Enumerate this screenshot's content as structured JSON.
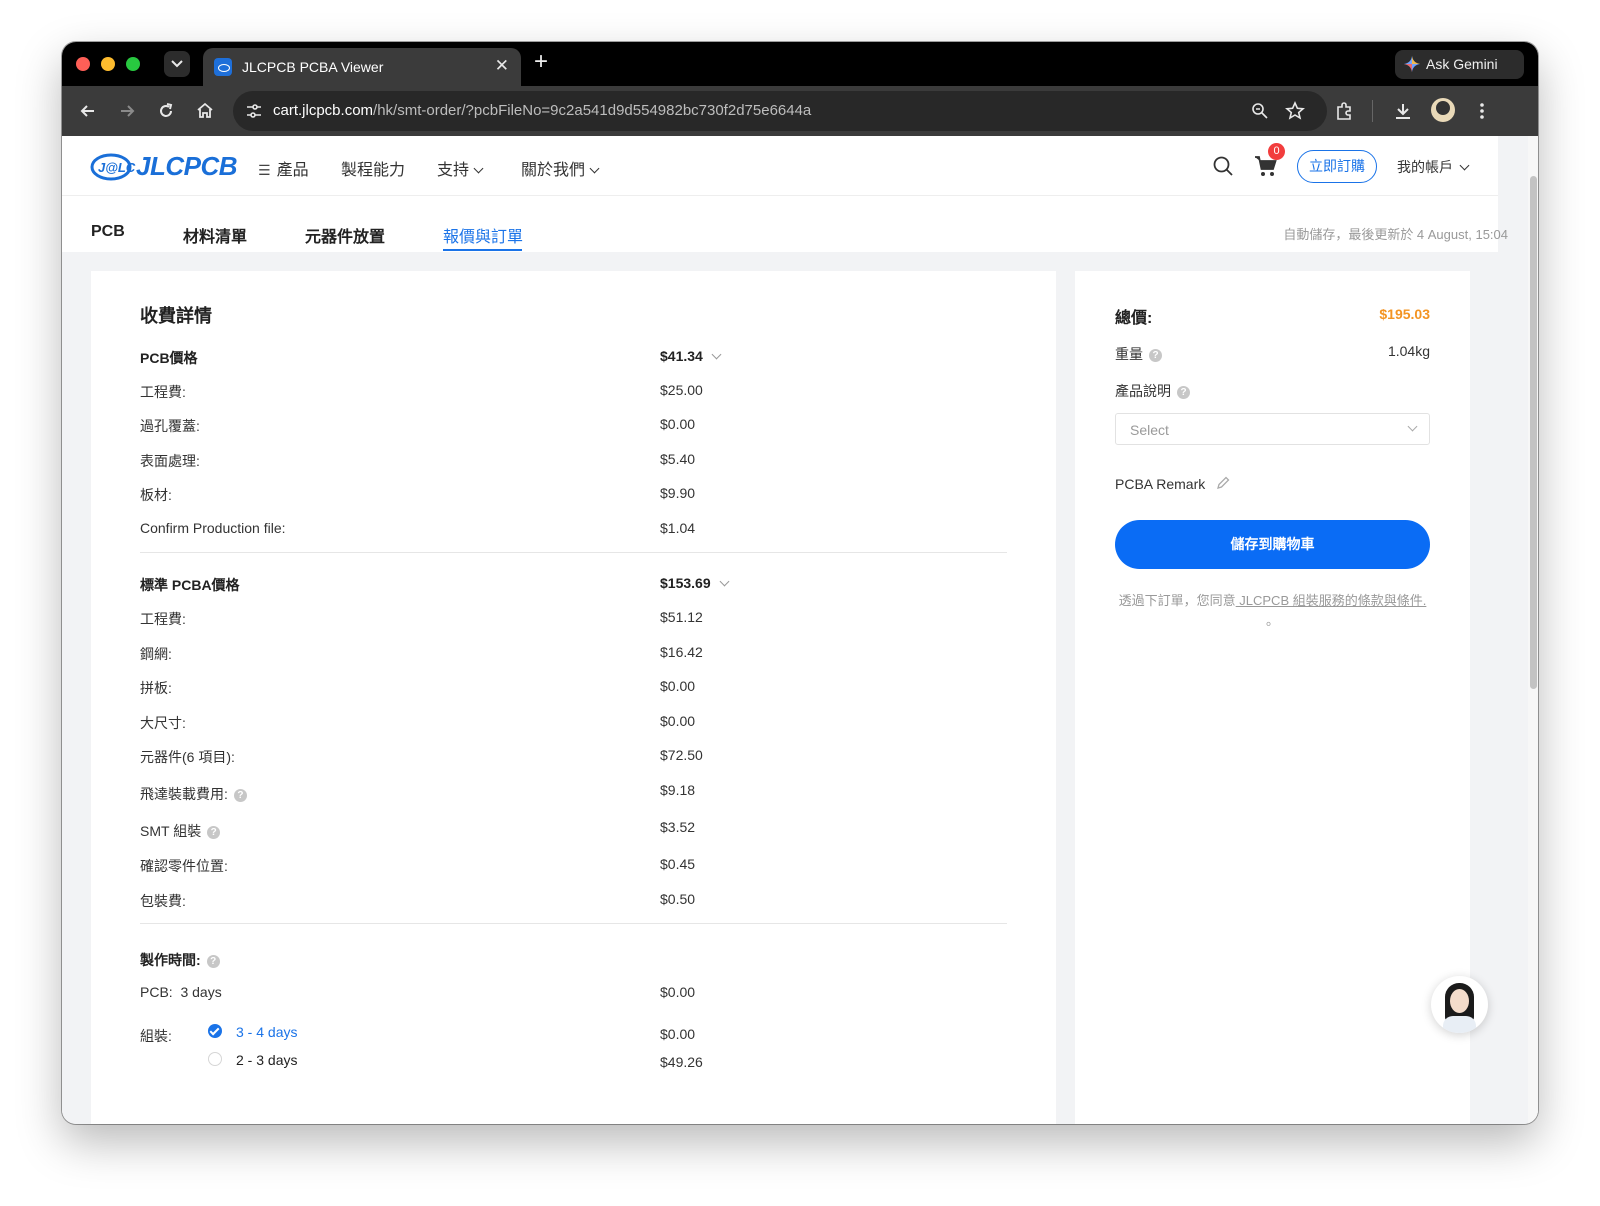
{
  "browser": {
    "tab_title": "JLCPCB PCBA Viewer",
    "new_tab_symbol": "+",
    "close_symbol": "✕",
    "gemini_label": "Ask Gemini",
    "url_host": "cart.jlcpcb.com",
    "url_path": "/hk/smt-order/?pcbFileNo=9c2a541d9d554982bc730f2d75e6644a"
  },
  "header": {
    "logo_text": "JLCPCB",
    "nav": {
      "products": "產品",
      "capabilities": "製程能力",
      "support": "支持",
      "about": "關於我們"
    },
    "cart_count": "0",
    "order_now": "立即訂購",
    "account": "我的帳戶"
  },
  "steps": {
    "pcb": "PCB",
    "bom": "材料清單",
    "placement": "元器件放置",
    "quote": "報價與訂單",
    "autosave": "自動儲存，最後更新於 4 August, 15:04"
  },
  "charges": {
    "title": "收費詳情",
    "pcb_group": {
      "label": "PCB價格",
      "total": "$41.34",
      "items": [
        {
          "label": "工程費:",
          "value": "$25.00"
        },
        {
          "label": "過孔覆蓋:",
          "value": "$0.00"
        },
        {
          "label": "表面處理:",
          "value": "$5.40"
        },
        {
          "label": "板材:",
          "value": "$9.90"
        },
        {
          "label": "Confirm Production file:",
          "value": "$1.04"
        }
      ]
    },
    "pcba_group": {
      "label": "標準 PCBA價格",
      "total": "$153.69",
      "items": [
        {
          "label": "工程費:",
          "value": "$51.12"
        },
        {
          "label": "鋼網:",
          "value": "$16.42"
        },
        {
          "label": "拼板:",
          "value": "$0.00"
        },
        {
          "label": "大尺寸:",
          "value": "$0.00"
        },
        {
          "label": "元器件(6 項目):",
          "value": "$72.50"
        },
        {
          "label": "飛達裝載費用:",
          "value": "$9.18"
        },
        {
          "label": "SMT 組裝",
          "value": "$3.52"
        },
        {
          "label": "確認零件位置:",
          "value": "$0.45"
        },
        {
          "label": "包裝費:",
          "value": "$0.50"
        }
      ]
    },
    "build_time": {
      "label": "製作時間:",
      "pcb_label": "PCB:",
      "pcb_days": "3 days",
      "pcb_value": "$0.00",
      "assembly_label": "組裝:",
      "options": [
        {
          "label": "3 - 4 days",
          "value": "$0.00",
          "selected": true
        },
        {
          "label": "2 - 3 days",
          "value": "$49.26",
          "selected": false
        }
      ]
    }
  },
  "summary": {
    "total_label": "總價:",
    "total_value": "$195.03",
    "weight_label": "重量",
    "weight_value": "1.04kg",
    "description_label": "產品說明",
    "select_placeholder": "Select",
    "remark_label": "PCBA Remark",
    "save_button": "儲存到購物車",
    "terms_prefix": "透過下訂單，您同意",
    "terms_link": " JLCPCB 組裝服務的條款與條件.",
    "terms_suffix": " 。"
  },
  "colors": {
    "brand_blue": "#1a73e8",
    "button_blue": "#0a6cf5",
    "total_orange": "#f39423",
    "badge_red": "#f23d3d"
  },
  "icons": [
    "chevron-down-icon",
    "search-icon",
    "cart-icon",
    "help-icon",
    "edit-icon",
    "check-icon"
  ]
}
